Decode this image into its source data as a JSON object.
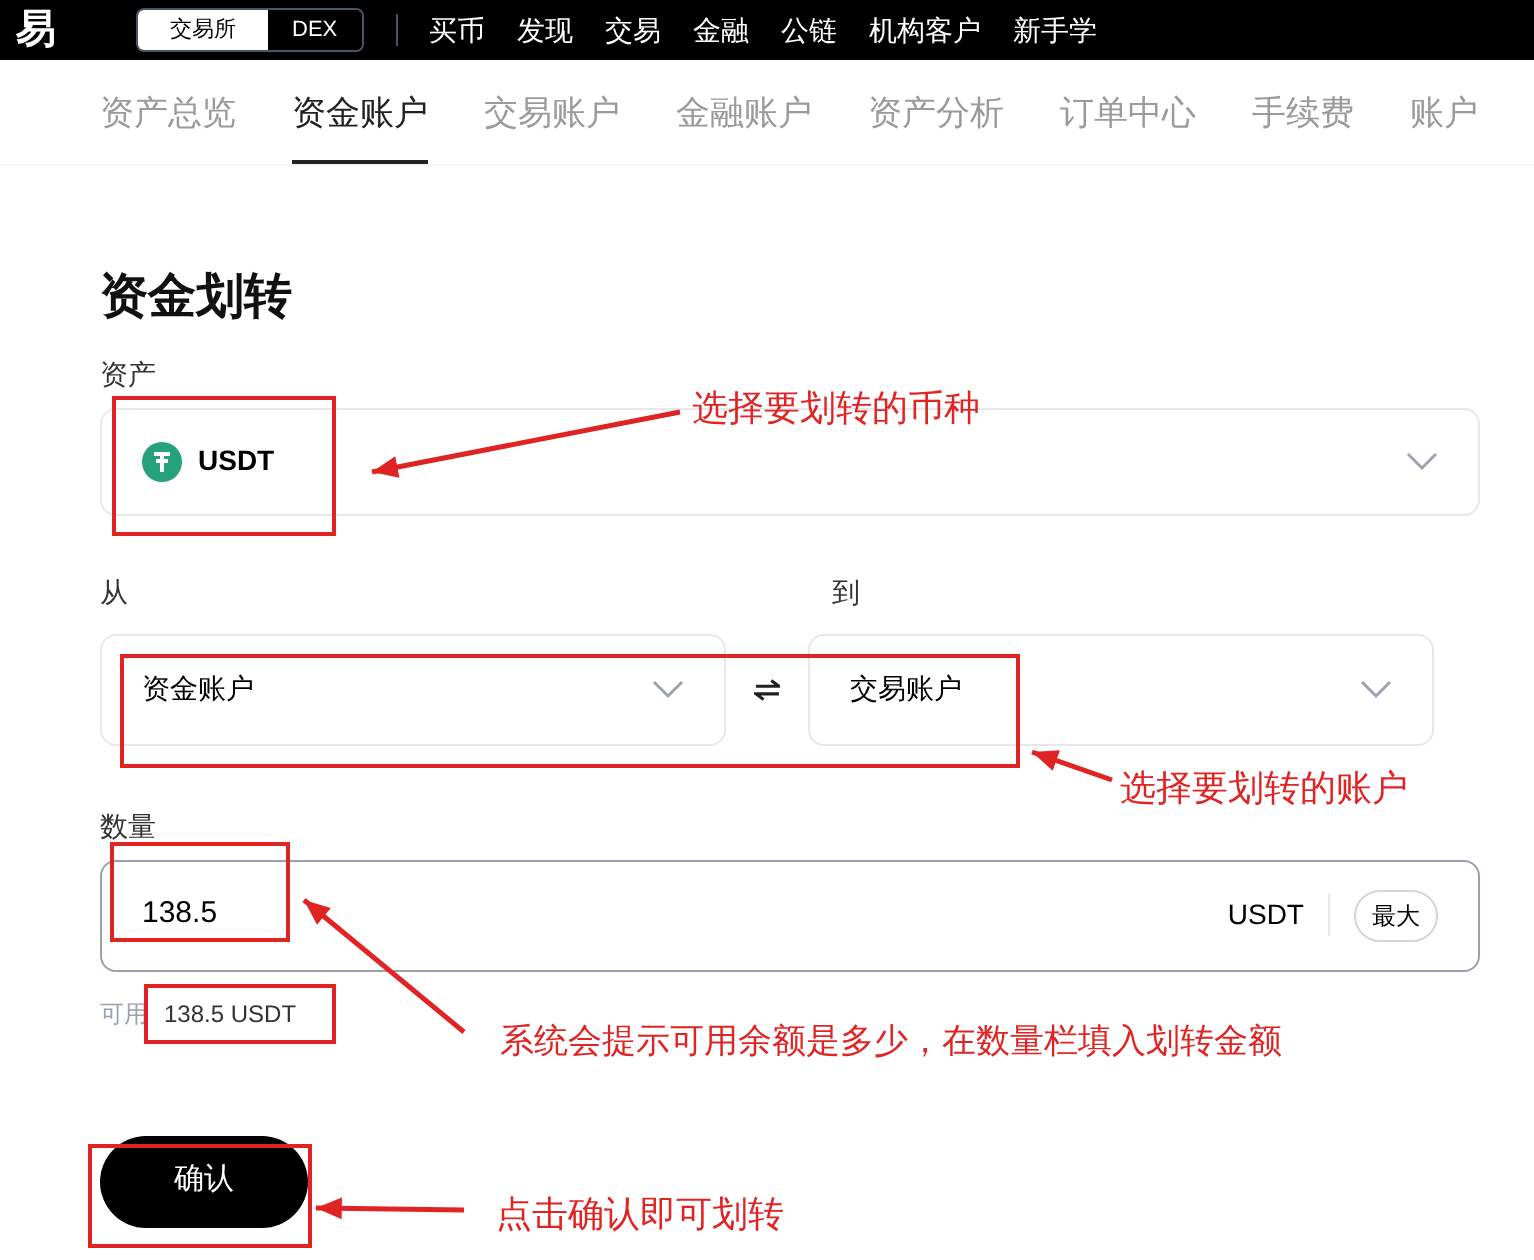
{
  "top_bar": {
    "logo": "易",
    "modes": [
      {
        "label": "交易所",
        "selected": true
      },
      {
        "label": "DEX",
        "selected": false
      }
    ],
    "menu": [
      "买币",
      "发现",
      "交易",
      "金融",
      "公链",
      "机构客户",
      "新手学"
    ]
  },
  "tabs": [
    {
      "label": "资产总览",
      "selected": false
    },
    {
      "label": "资金账户",
      "selected": true
    },
    {
      "label": "交易账户",
      "selected": false
    },
    {
      "label": "金融账户",
      "selected": false
    },
    {
      "label": "资产分析",
      "selected": false
    },
    {
      "label": "订单中心",
      "selected": false
    },
    {
      "label": "手续费",
      "selected": false
    },
    {
      "label": "账户",
      "selected": false
    }
  ],
  "form": {
    "title": "资金划转",
    "asset_label": "资产",
    "asset": "USDT",
    "from_label": "从",
    "from": "资金账户",
    "to_label": "到",
    "to": "交易账户",
    "amount_label": "数量",
    "amount": "138.5",
    "amount_unit": "USDT",
    "max_button": "最大",
    "available_label": "可用",
    "available": "138.5 USDT",
    "confirm_button": "确认"
  },
  "annotations": [
    "选择要划转的币种",
    "选择要划转的账户",
    "系统会提示可用余额是多少，在数量栏填入划转金额",
    "点击确认即可划转"
  ]
}
